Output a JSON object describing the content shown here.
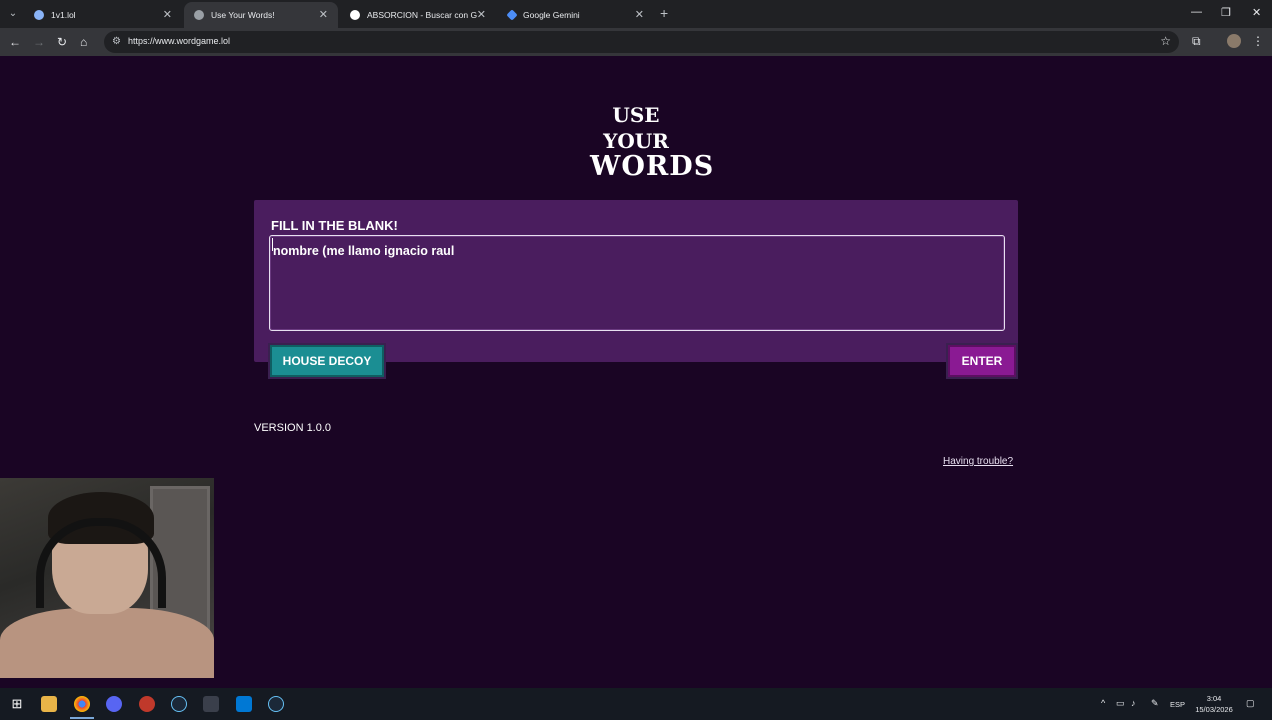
{
  "browser": {
    "tabs": [
      {
        "title": "1v1.lol",
        "active": false,
        "favicon_color": "#8ab4f8"
      },
      {
        "title": "Use Your Words!",
        "active": true,
        "favicon_color": "#9aa0a6"
      },
      {
        "title": "ABSORCION - Buscar con Goog",
        "active": false,
        "favicon_color": "#ffffff"
      },
      {
        "title": "Google Gemini",
        "active": false,
        "favicon_color": "#4c8df6"
      }
    ],
    "url": "https://www.wordgame.lol"
  },
  "logo": {
    "line1": "USE YOUR",
    "line2": "WORDS"
  },
  "prompt": {
    "title": "FILL IN THE BLANK!",
    "answer_value": "nombre (me llamo ignacio raul "
  },
  "buttons": {
    "decoy": "HOUSE DECOY",
    "enter": "ENTER"
  },
  "footer": {
    "version": "VERSION 1.0.0",
    "trouble_link": "Having trouble?"
  },
  "taskbar": {
    "language": "ESP",
    "time": "3:04",
    "date": "15/03/2026"
  },
  "colors": {
    "page_bg": "#1a0524",
    "card_bg": "#4a1d5e",
    "decoy_btn": "#1b8e93",
    "enter_btn": "#8a1a93"
  }
}
